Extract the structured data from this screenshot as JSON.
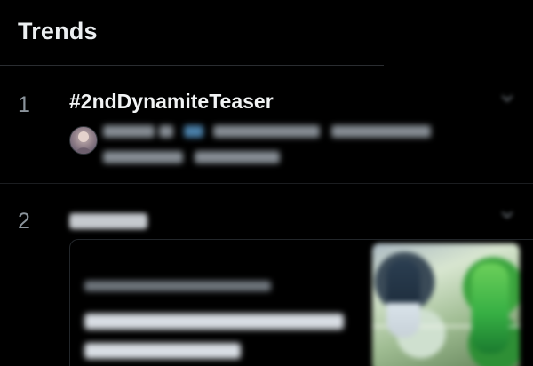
{
  "header": {
    "title": "Trends"
  },
  "trends": [
    {
      "rank": "1",
      "name": "#2ndDynamiteTeaser"
    },
    {
      "rank": "2"
    }
  ],
  "icons": {
    "chevron": "chevron-down-icon",
    "avatar": "user-avatar"
  },
  "colors": {
    "background": "#000000",
    "primary_text": "#f1f3f4",
    "secondary_text": "#8b949c",
    "divider": "#1b1d20"
  }
}
